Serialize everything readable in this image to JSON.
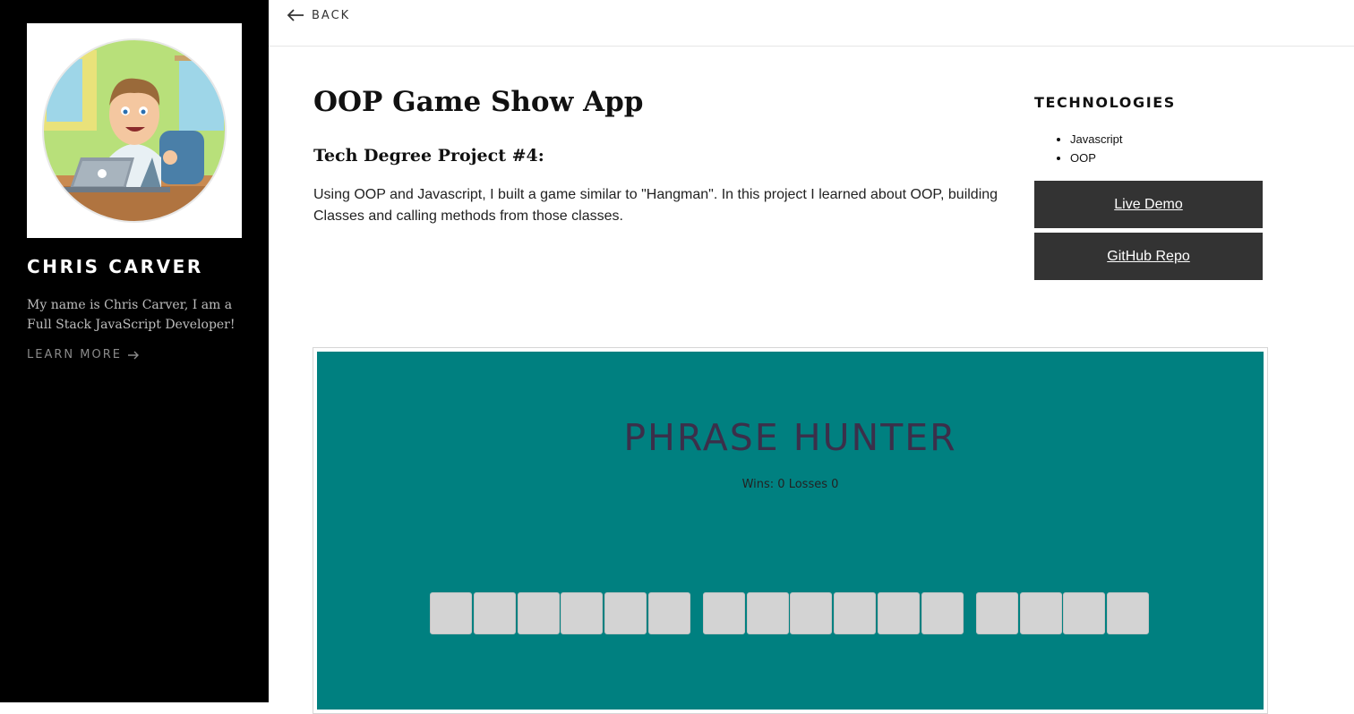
{
  "sidebar": {
    "name": "CHRIS CARVER",
    "bio": "My name is Chris Carver, I am a Full Stack JavaScript Developer!",
    "learn_more": "LEARN MORE"
  },
  "topbar": {
    "back": "BACK"
  },
  "project": {
    "title": "OOP Game Show App",
    "subtitle": "Tech Degree Project #4:",
    "description": "Using OOP and Javascript, I built a game similar to \"Hangman\". In this project I learned about OOP, building Classes and calling methods from those classes."
  },
  "technologies": {
    "heading": "TECHNOLOGIES",
    "items": [
      "Javascript",
      "OOP"
    ]
  },
  "buttons": {
    "live_demo": "Live Demo",
    "github_repo": "GitHub Repo"
  },
  "game": {
    "title": "PHRASE HUNTER",
    "score": "Wins: 0 Losses 0",
    "word_lengths": [
      6,
      6,
      4
    ]
  },
  "colors": {
    "sidebar_bg": "#000000",
    "button_bg": "#333333",
    "game_bg": "#008080",
    "game_title": "#3b2f4a",
    "tile": "#d3d3d3"
  },
  "icons": {
    "back": "arrow-left-icon",
    "learn_more": "arrow-right-icon",
    "avatar": "avatar-illustration"
  }
}
